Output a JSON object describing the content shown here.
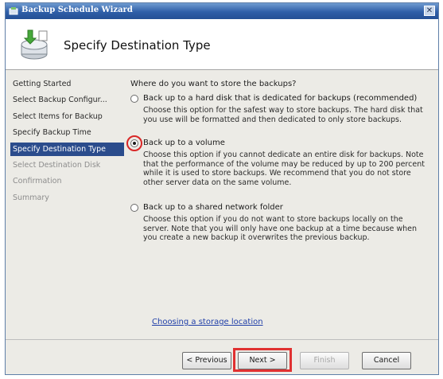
{
  "window": {
    "title": "Backup Schedule Wizard",
    "close_label": "✕"
  },
  "banner": {
    "heading": "Specify Destination Type"
  },
  "nav": {
    "items": [
      {
        "label": "Getting Started",
        "state": "done"
      },
      {
        "label": "Select Backup Configur...",
        "state": "done"
      },
      {
        "label": "Select Items for Backup",
        "state": "done"
      },
      {
        "label": "Specify Backup Time",
        "state": "done"
      },
      {
        "label": "Specify Destination Type",
        "state": "active"
      },
      {
        "label": "Select Destination Disk",
        "state": "pending"
      },
      {
        "label": "Confirmation",
        "state": "pending"
      },
      {
        "label": "Summary",
        "state": "pending"
      }
    ]
  },
  "content": {
    "question": "Where do you want to store the backups?",
    "options": [
      {
        "label": "Back up to a hard disk that is dedicated for backups (recommended)",
        "description": "Choose this option for the safest way to store backups. The hard disk that you use will be formatted and then dedicated to only store backups.",
        "checked": false
      },
      {
        "label": "Back up to a volume",
        "description": "Choose this option if you cannot dedicate an entire disk for backups. Note that the performance of the volume may be reduced by up to 200 percent while it is used to store backups. We recommend that you do not store other server data on the same volume.",
        "checked": true
      },
      {
        "label": "Back up to a shared network folder",
        "description": "Choose this option if you do not want to store backups locally on the server. Note that you will only have one backup at a time because when you create a new backup it overwrites the previous backup.",
        "checked": false
      }
    ],
    "link": "Choosing a storage location"
  },
  "footer": {
    "previous": "< Previous",
    "next": "Next >",
    "finish": "Finish",
    "cancel": "Cancel"
  },
  "colors": {
    "title_bar": "#2f5fa8",
    "nav_active": "#2b4c8c",
    "highlight": "#e03131",
    "link": "#1f3ea8"
  }
}
